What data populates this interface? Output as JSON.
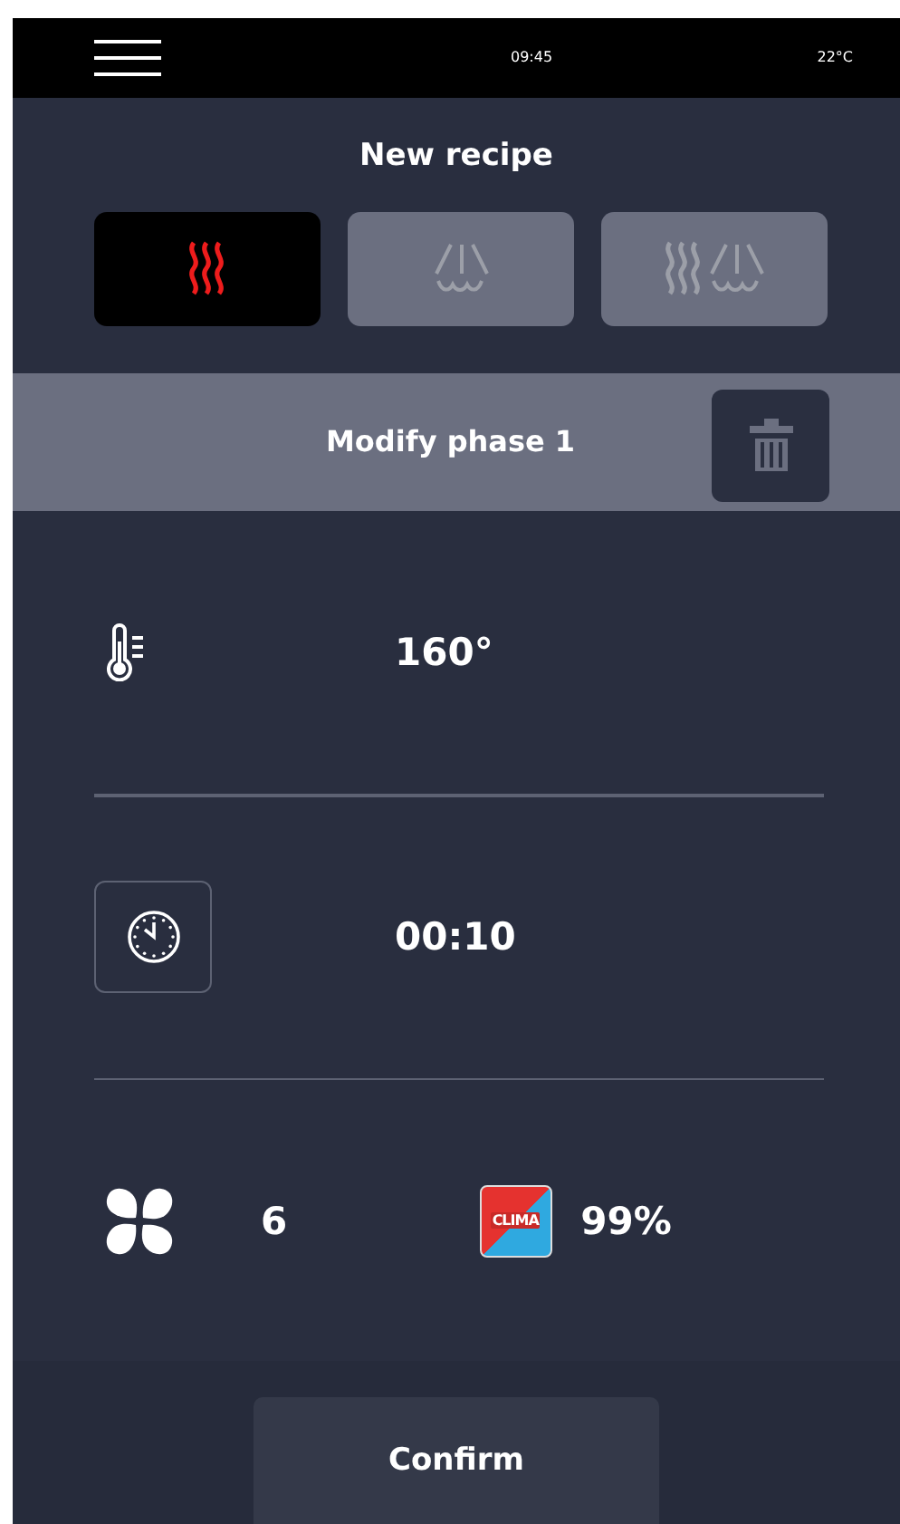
{
  "status_bar": {
    "time": "09:45",
    "temperature": "22°C"
  },
  "title": "New recipe",
  "modes": [
    {
      "kind": "heat",
      "selected": true
    },
    {
      "kind": "steam",
      "selected": false
    },
    {
      "kind": "combi",
      "selected": false
    }
  ],
  "phase": {
    "title": "Modify phase 1"
  },
  "temperature": "160°",
  "time": "00:10",
  "fan_speed": "6",
  "clima": {
    "logo": "CLIMA",
    "value": "99%"
  },
  "confirm": "Confirm"
}
